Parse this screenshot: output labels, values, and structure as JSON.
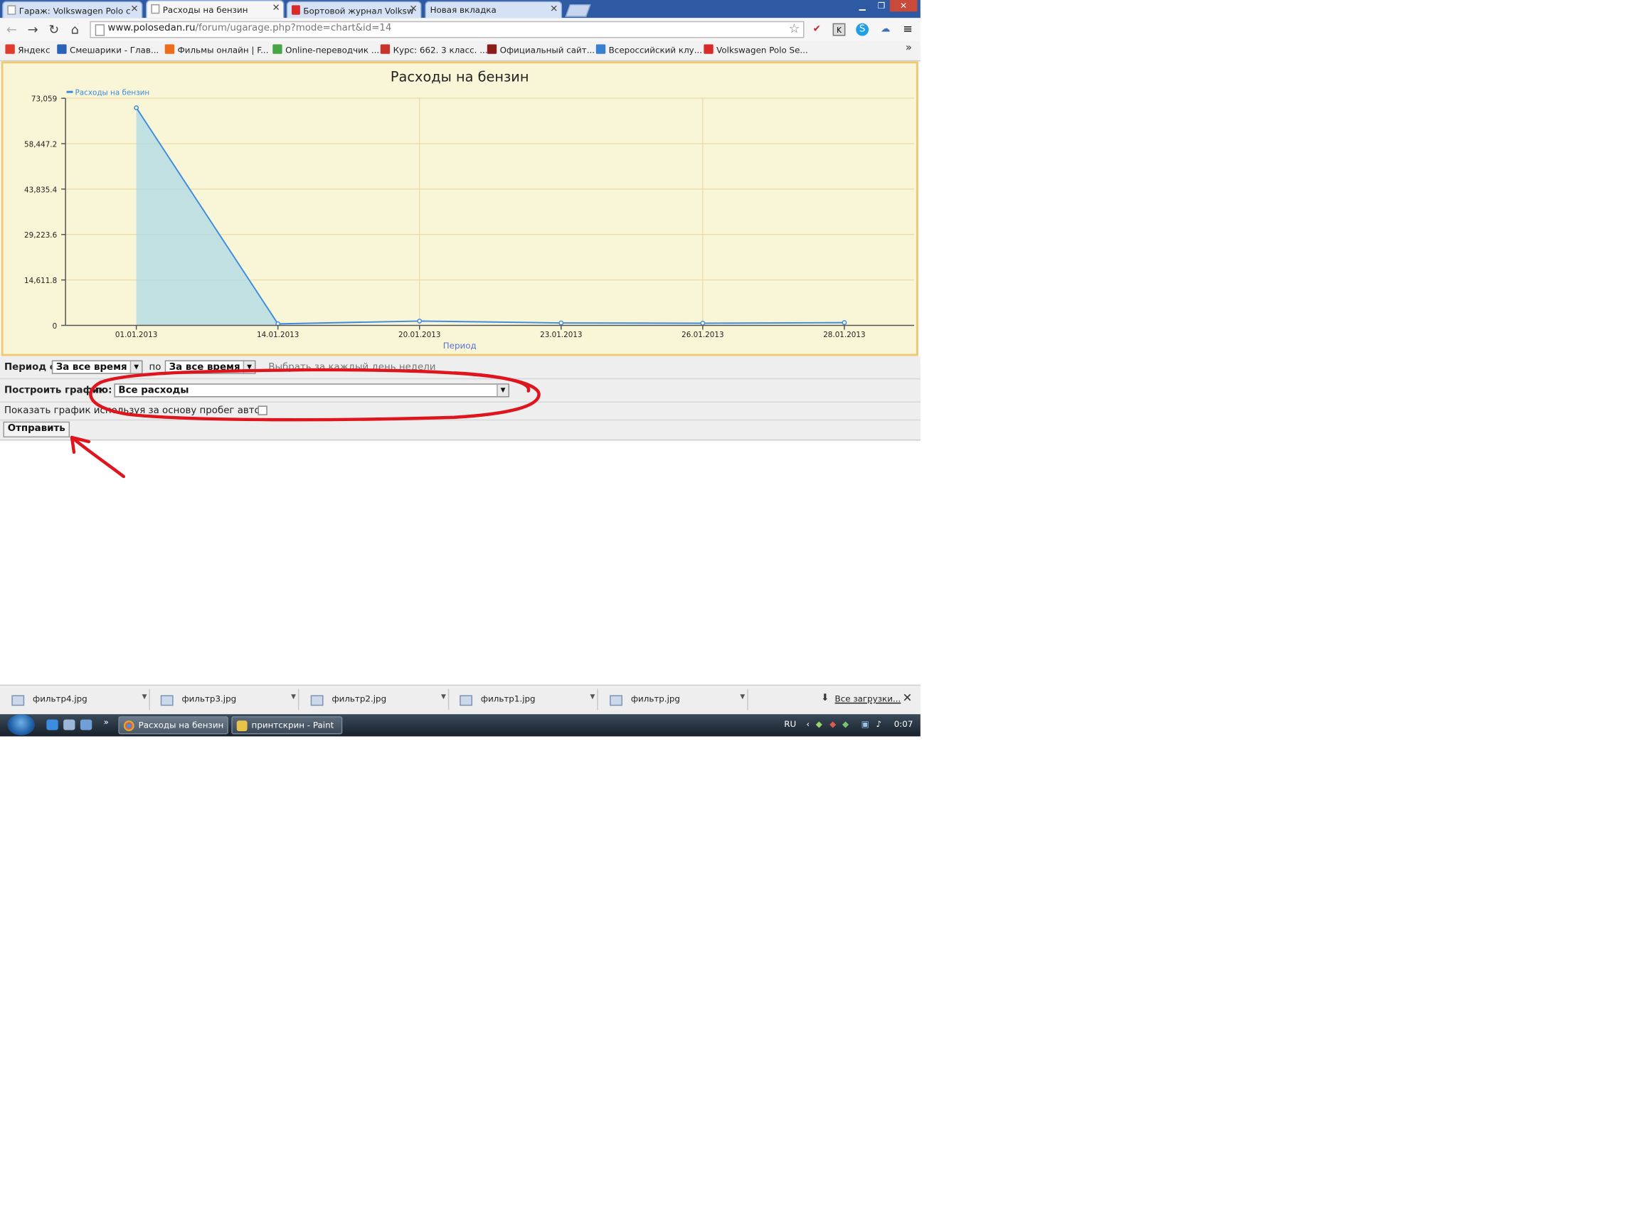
{
  "browser": {
    "tabs": [
      {
        "label": "Гараж: Volkswagen Polo с",
        "icon": "page-icon",
        "active": false
      },
      {
        "label": "Расходы на бензин",
        "icon": "page-icon",
        "active": true
      },
      {
        "label": "Бортовой журнал Volksw",
        "icon": "red-d-icon",
        "active": false
      },
      {
        "label": "Новая вкладка",
        "icon": "none",
        "active": false
      }
    ],
    "url_host": "www.polosedan.ru",
    "url_path": "/forum/ugarage.php?mode=chart&id=14",
    "bookmarks": [
      "Яндекс",
      "Смешарики - Глав...",
      "Фильмы онлайн | F...",
      "Online-переводчик ...",
      "Курс: 662. 3 класс. ...",
      "Официальный сайт...",
      "Всероссийский клу...",
      "Volkswagen Polo Se..."
    ],
    "bookmark_more": "»"
  },
  "chart_data": {
    "type": "area",
    "title": "Расходы на бензин",
    "xlabel": "Период",
    "ylabel": "",
    "x": [
      "01.01.2013",
      "14.01.2013",
      "20.01.2013",
      "23.01.2013",
      "26.01.2013",
      "28.01.2013"
    ],
    "series": [
      {
        "name": "Расходы на бензин",
        "values": [
          70000,
          500,
          1400,
          800,
          700,
          900
        ],
        "color": "#3d8ce0"
      }
    ],
    "yticks": [
      "0",
      "14,611.8",
      "29,223.6",
      "43,835.4",
      "58,447.2",
      "73,059"
    ],
    "ylim": [
      0,
      73059
    ],
    "grid": true,
    "fill_color": "#add8e6",
    "background": "#f8f6d6"
  },
  "form": {
    "period_from_label": "Период с",
    "period_from_value": "За все время",
    "period_to_label": "по",
    "period_to_value": "За все время",
    "period_hint": "Выбрать за каждый день недели",
    "build_label": "Построить график",
    "build_by_label": "по:",
    "build_by_value": "Все расходы",
    "mileage_label": "Показать график используя за основу пробег авто",
    "mileage_checked": false,
    "submit_label": "Отправить"
  },
  "annotation_color": "#e0141c",
  "downloads": {
    "items": [
      "фильтр4.jpg",
      "фильтр3.jpg",
      "фильтр2.jpg",
      "фильтр1.jpg",
      "фильтр.jpg"
    ],
    "all_label": "Все загрузки...",
    "close": "✕"
  },
  "taskbar": {
    "items": [
      {
        "label": "Расходы на бензин ...",
        "icon": "chrome-icon"
      },
      {
        "label": "принтскрин - Paint",
        "icon": "paint-icon"
      }
    ],
    "more": "»",
    "language": "RU",
    "time": "0:07"
  }
}
